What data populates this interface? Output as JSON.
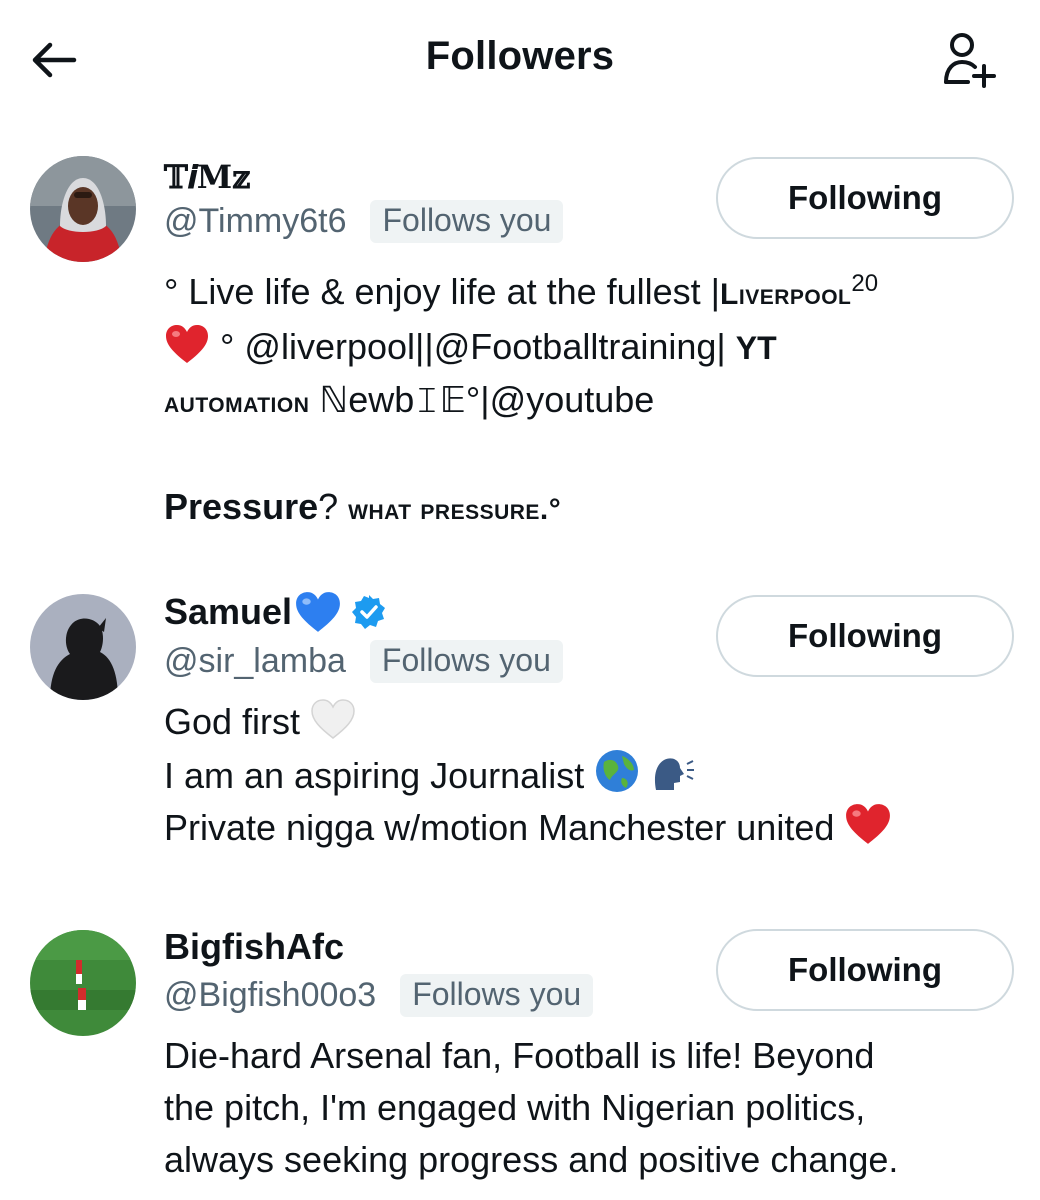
{
  "header": {
    "title": "Followers",
    "back_icon": "arrow-left-icon",
    "add_icon": "add-user-icon"
  },
  "followers": [
    {
      "display_name": "𝕋𝒊M𝕫",
      "handle": "@Timmy6t6",
      "follows_you": "Follows you",
      "button_label": "Following",
      "bio": {
        "line1_a": "° Live life & enjoy life at the fullest |",
        "line1_b": "Liverpool",
        "line1_c": "20",
        "line2_a": "° @liverpool||@Footballtraining| ",
        "line2_b": "YT",
        "line3_a": "automation",
        "line3_b": " ℕewb𝙸𝔼°|@youtube",
        "line5_a": "Pressure",
        "line5_b": "? ",
        "line5_c": "what pressure.°"
      }
    },
    {
      "display_name": "Samuel",
      "handle": "@sir_lamba",
      "follows_you": "Follows you",
      "button_label": "Following",
      "bio": {
        "line1": "God first",
        "line2": "I am an aspiring Journalist",
        "line3": "Private nigga w/motion Manchester united"
      }
    },
    {
      "display_name": "BigfishAfc",
      "handle": "@Bigfish00o3",
      "follows_you": "Follows you",
      "button_label": "Following",
      "bio": {
        "line1": "Die-hard Arsenal fan, Football is life! Beyond",
        "line2": "the pitch, I'm engaged with Nigerian politics,",
        "line3": "always seeking progress and positive change."
      }
    }
  ],
  "colors": {
    "text": "#0f1419",
    "secondary": "#536471",
    "badge_bg": "#eff3f4",
    "border": "#cfd9de",
    "verified": "#1d9bf0"
  }
}
